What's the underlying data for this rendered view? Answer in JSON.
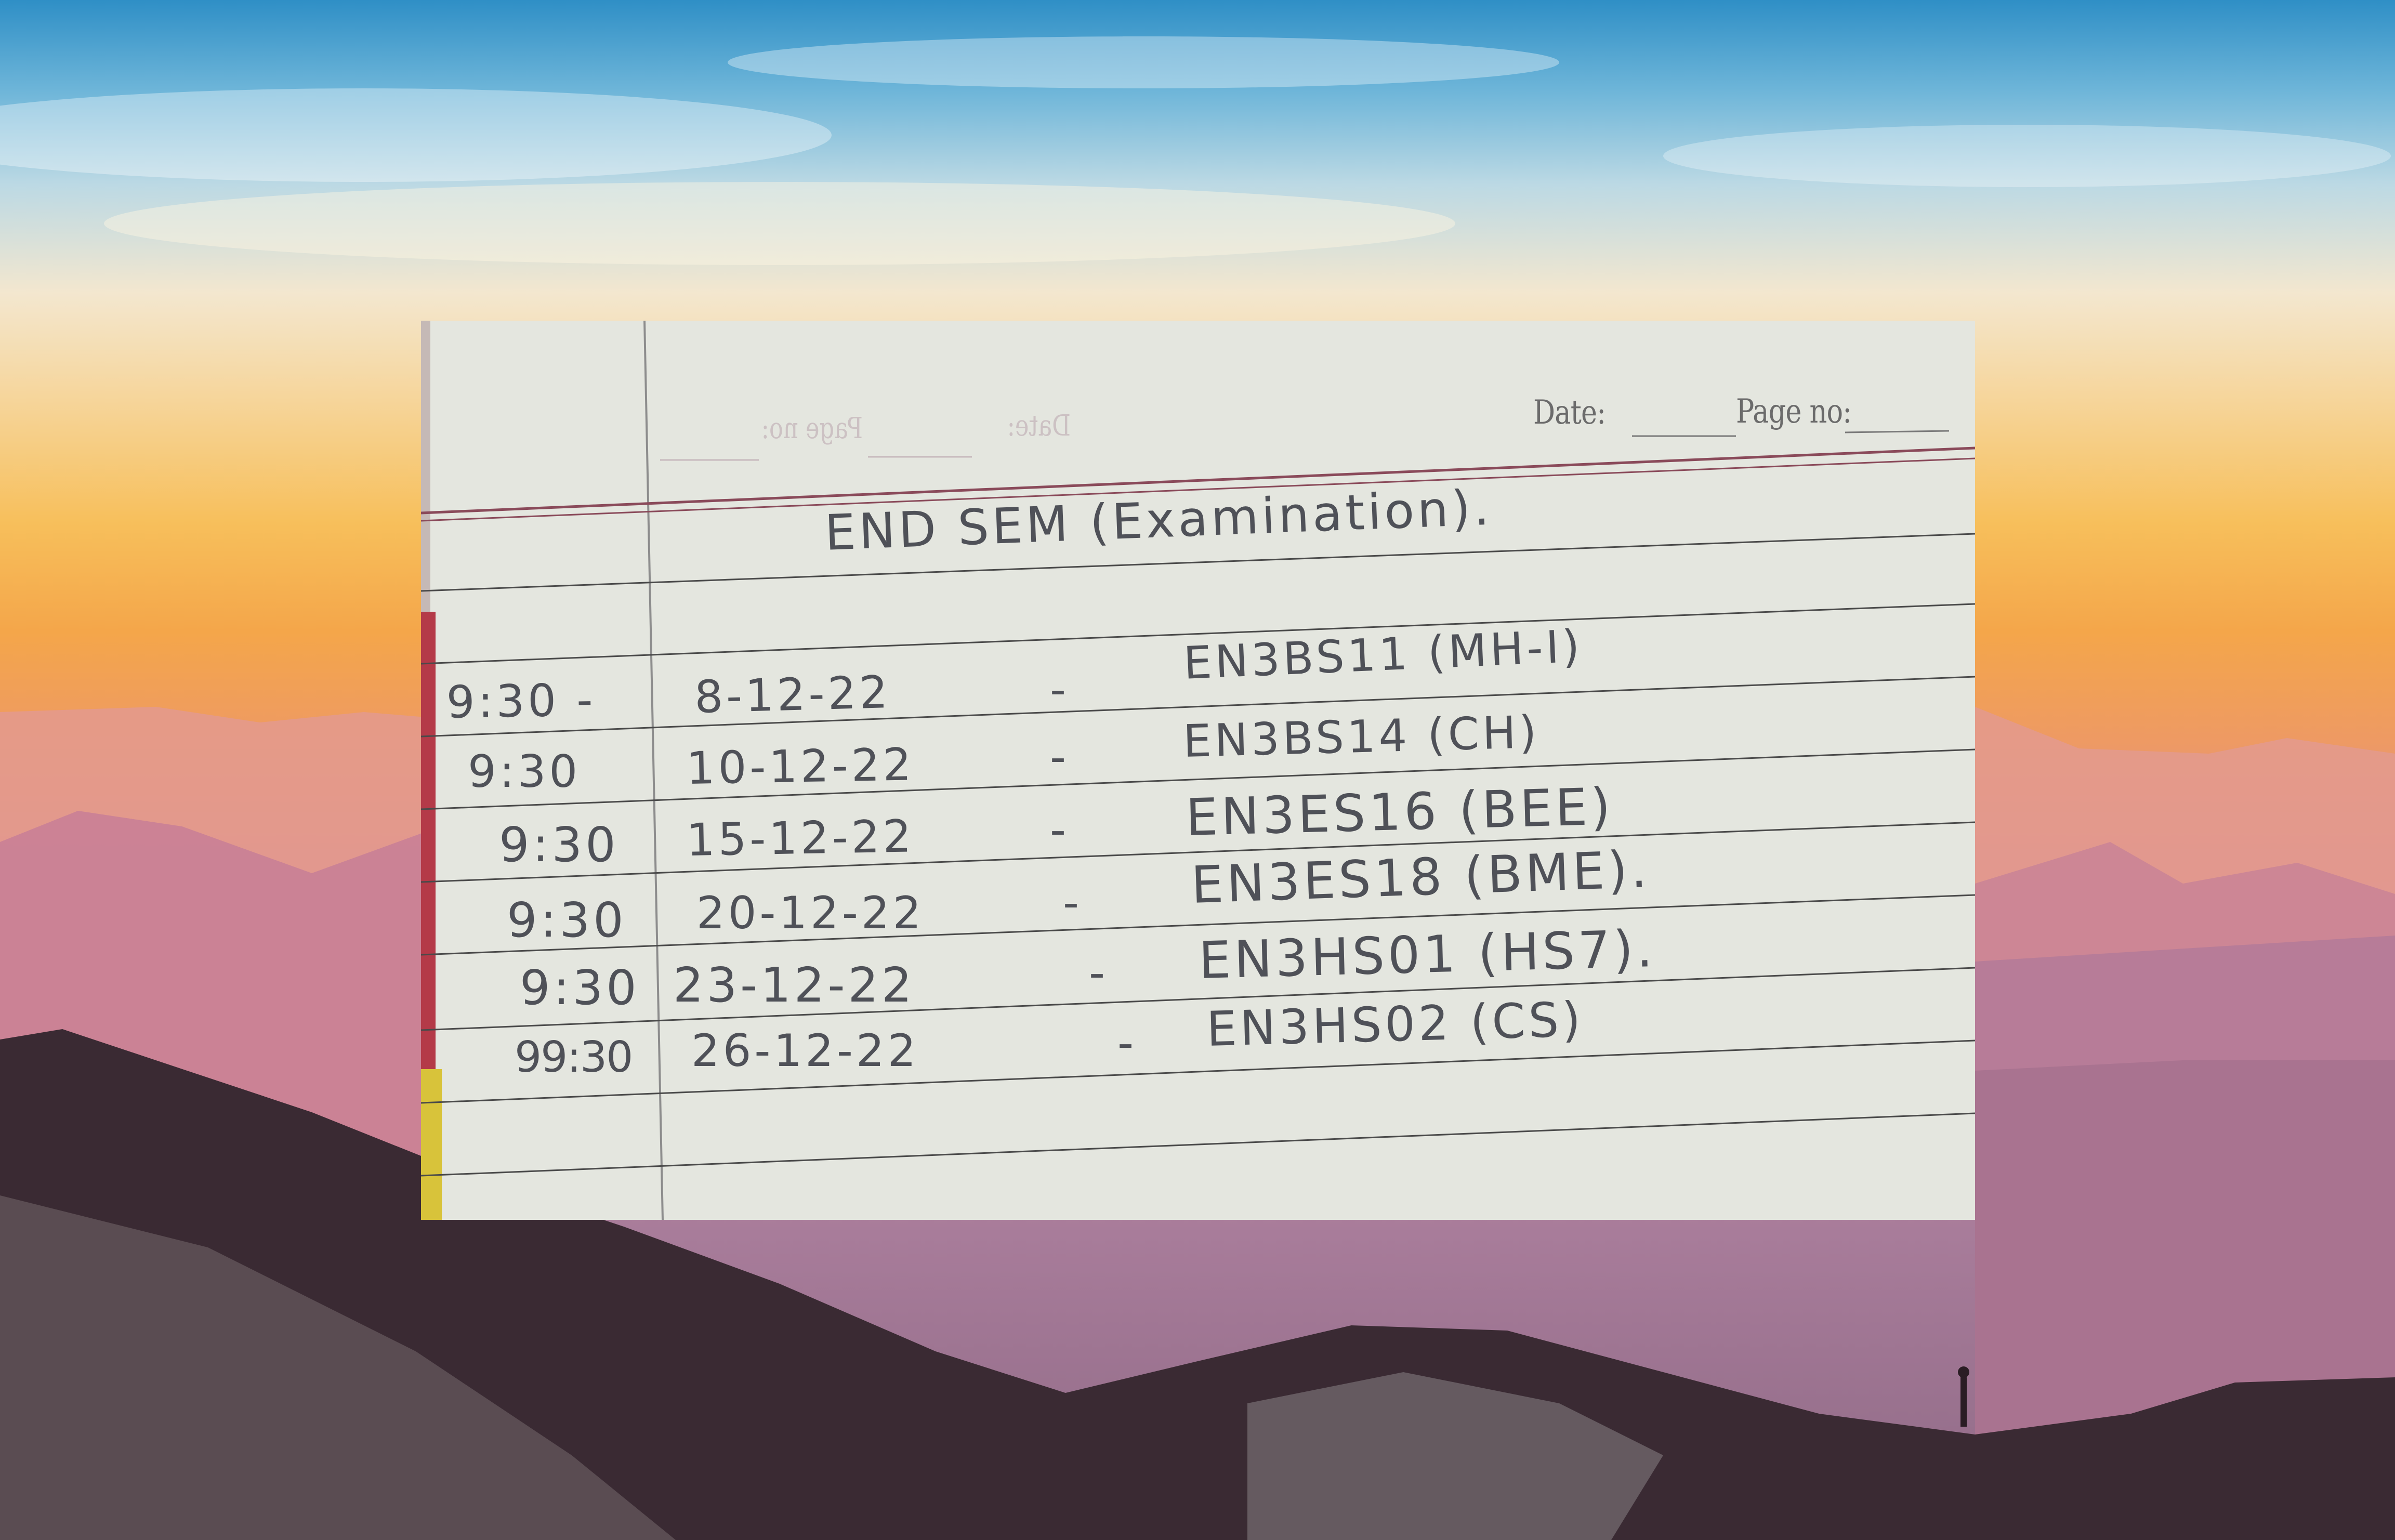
{
  "sheet": {
    "header": {
      "date_label": "Date:",
      "page_label": "Page no:"
    },
    "title": "END SEM (Examination).",
    "rows": [
      {
        "time": "9:30 -",
        "date": "8-12-22",
        "dash": "-",
        "course": "EN3BS11 (MH-I)"
      },
      {
        "time": "9:30",
        "date": "10-12-22",
        "dash": "-",
        "course": "EN3BS14 (CH)"
      },
      {
        "time": "9:30",
        "date": "15-12-22",
        "dash": "-",
        "course": "EN3ES16 (BEE)"
      },
      {
        "time": "9:30",
        "date": "20-12-22",
        "dash": "-",
        "course": "EN3ES18 (BME)."
      },
      {
        "time": "9:30",
        "date": "23-12-22",
        "dash": "-",
        "course": "EN3HS01 (HS7)."
      },
      {
        "time": "99:30",
        "date": "26-12-22",
        "dash": "-",
        "course": "EN3HS02 (CS)"
      }
    ]
  },
  "colors": {
    "paper": "#e4e6df",
    "ruling": "#4a4a4a",
    "header_rule": "#8a4a5a",
    "ink": "#4f5158"
  }
}
